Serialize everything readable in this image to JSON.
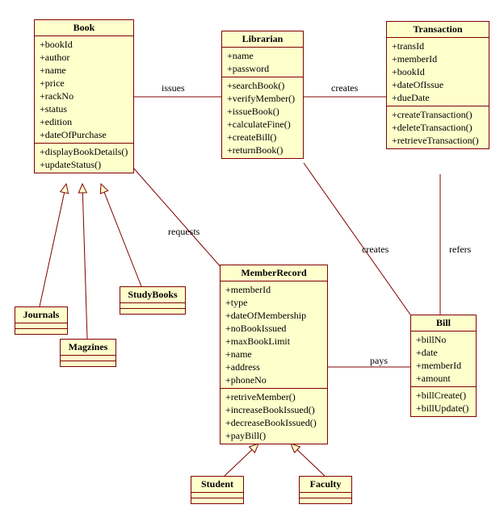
{
  "classes": {
    "book": {
      "title": "Book",
      "attrs": [
        "+bookId",
        "+author",
        "+name",
        "+price",
        "+rackNo",
        "+status",
        "+edition",
        "+dateOfPurchase"
      ],
      "ops": [
        "+displayBookDetails()",
        "+updateStatus()"
      ]
    },
    "librarian": {
      "title": "Librarian",
      "attrs": [
        "+name",
        "+password"
      ],
      "ops": [
        "+searchBook()",
        "+verifyMember()",
        "+issueBook()",
        "+calculateFine()",
        "+createBill()",
        "+returnBook()"
      ]
    },
    "transaction": {
      "title": "Transaction",
      "attrs": [
        "+transId",
        "+memberId",
        "+bookId",
        "+dateOfIssue",
        "+dueDate"
      ],
      "ops": [
        "+createTransaction()",
        "+deleteTransaction()",
        "+retrieveTransaction()"
      ]
    },
    "journals": {
      "title": "Journals"
    },
    "magzines": {
      "title": "Magzines"
    },
    "studybooks": {
      "title": "StudyBooks"
    },
    "memberrecord": {
      "title": "MemberRecord",
      "attrs": [
        "+memberId",
        "+type",
        "+dateOfMembership",
        "+noBookIssued",
        "+maxBookLimit",
        "+name",
        "+address",
        "+phoneNo"
      ],
      "ops": [
        "+retriveMember()",
        "+increaseBookIssued()",
        "+decreaseBookIssued()",
        "+payBill()"
      ]
    },
    "bill": {
      "title": "Bill",
      "attrs": [
        "+billNo",
        "+date",
        "+memberId",
        "+amount"
      ],
      "ops": [
        "+billCreate()",
        "+billUpdate()"
      ]
    },
    "student": {
      "title": "Student"
    },
    "faculty": {
      "title": "Faculty"
    }
  },
  "labels": {
    "issues": "issues",
    "creates1": "creates",
    "requests": "requests",
    "creates2": "creates",
    "refers": "refers",
    "pays": "pays"
  }
}
